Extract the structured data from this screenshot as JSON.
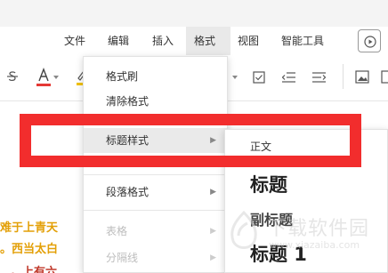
{
  "menubar": {
    "items": [
      "文件",
      "编辑",
      "插入",
      "格式",
      "视图",
      "智能工具"
    ],
    "active_index": 3
  },
  "document": {
    "lines": [
      "难于上青天",
      "。西当太白",
      "。上有六"
    ]
  },
  "dropdown": {
    "items": [
      {
        "label": "格式刷",
        "has_submenu": false,
        "disabled": false
      },
      {
        "label": "清除格式",
        "has_submenu": false,
        "disabled": false
      },
      {
        "label": "标题样式",
        "has_submenu": true,
        "disabled": false,
        "highlighted": true
      },
      {
        "label": "段落格式",
        "has_submenu": true,
        "disabled": false
      },
      {
        "label": "表格",
        "has_submenu": true,
        "disabled": true
      },
      {
        "label": "分隔线",
        "has_submenu": true,
        "disabled": true
      }
    ]
  },
  "submenu": {
    "items": [
      "正文",
      "标题",
      "副标题",
      "标题 1"
    ]
  },
  "watermark": {
    "text": "下载软件园",
    "url": "www.xiazaiba.com"
  },
  "colors": {
    "highlight": "#f22d2d",
    "doc_text": "#e3a008"
  }
}
